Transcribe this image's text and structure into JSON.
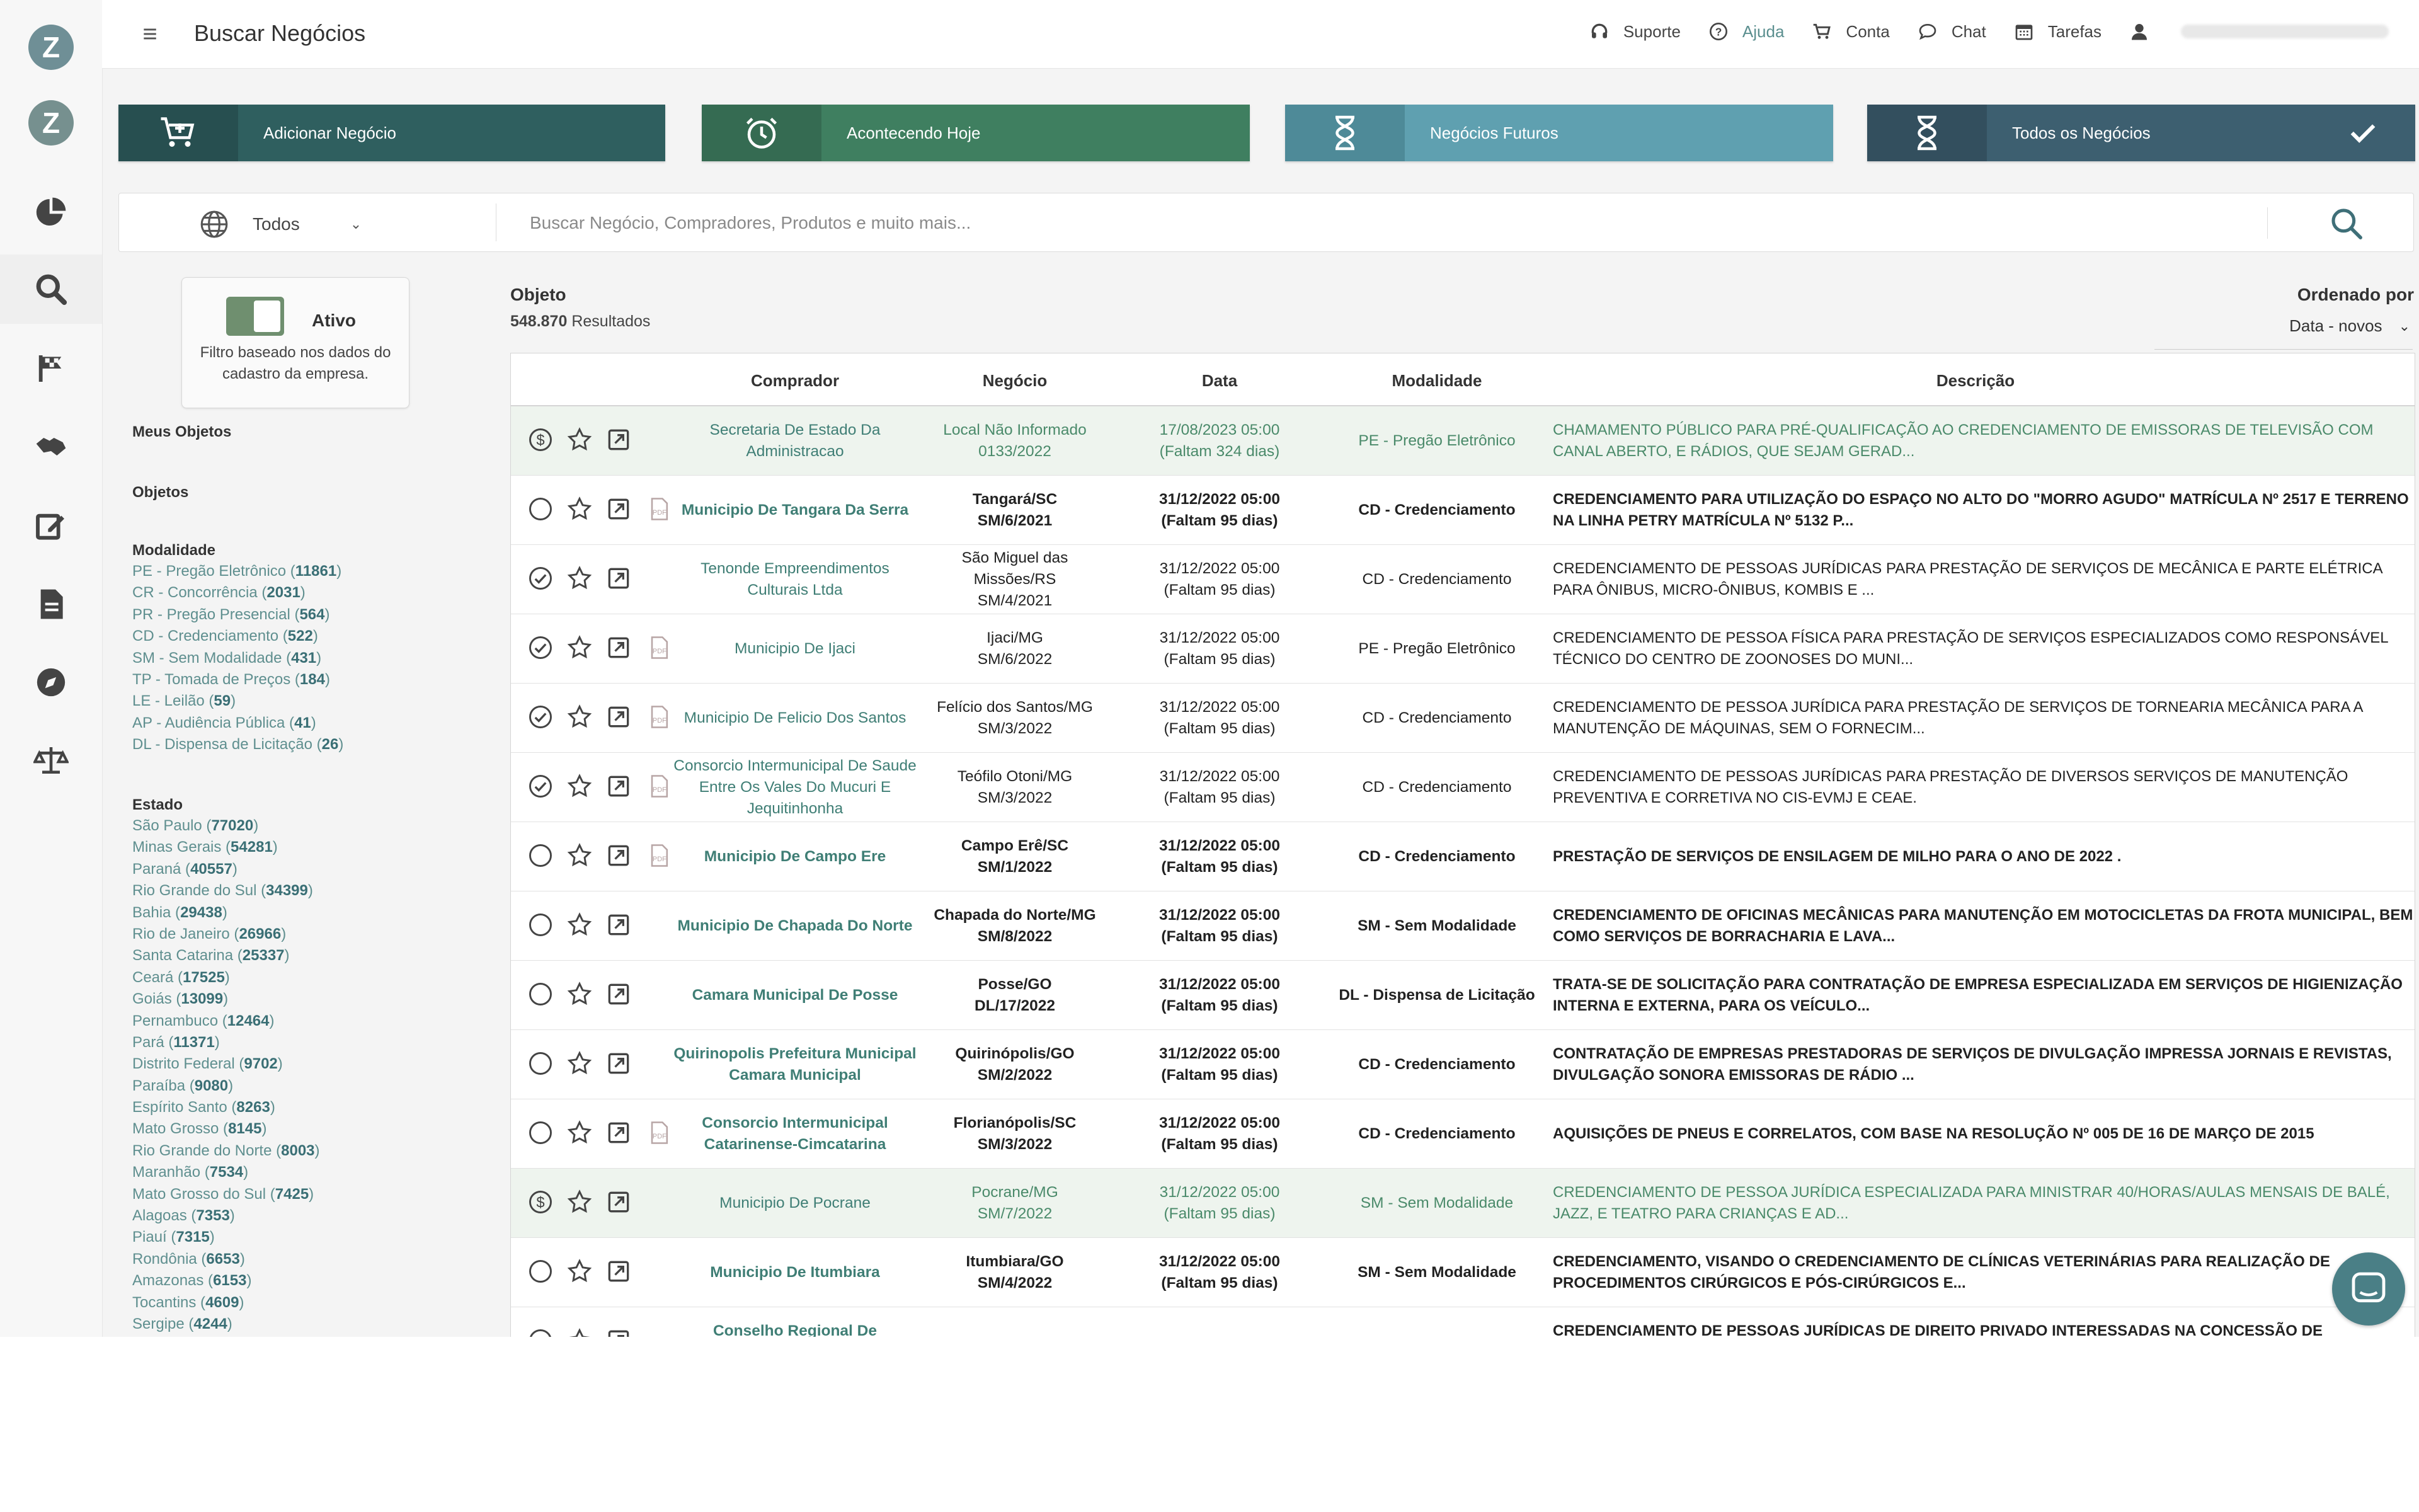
{
  "header": {
    "title": "Buscar Negócios",
    "nav": [
      {
        "label": "Suporte",
        "icon": "headset-icon"
      },
      {
        "label": "Ajuda",
        "icon": "help-circle-icon"
      },
      {
        "label": "Conta",
        "icon": "cart-icon"
      },
      {
        "label": "Chat",
        "icon": "chat-bubble-icon"
      },
      {
        "label": "Tarefas",
        "icon": "calendar-icon"
      }
    ]
  },
  "rail": [
    "logo-icon",
    "logo-icon",
    "pie-chart-icon",
    "search-icon",
    "flag-icon",
    "handshake-icon",
    "edit-icon",
    "document-icon",
    "compass-icon",
    "scales-icon"
  ],
  "tiles": [
    {
      "label": "Adicionar Negócio",
      "color": "#2f5f5f",
      "icon_bg": "#274f50"
    },
    {
      "label": "Acontecendo Hoje",
      "color": "#3f7f60",
      "icon_bg": "#356b52"
    },
    {
      "label": "Negócios Futuros",
      "color": "#5fa0b0",
      "icon_bg": "#4e8a98"
    },
    {
      "label": "Todos os Negócios",
      "color": "#3d5f70",
      "icon_bg": "#334f5e"
    }
  ],
  "search": {
    "scope": "Todos",
    "placeholder": "Buscar Negócio, Compradores, Produtos e muito mais..."
  },
  "filters": {
    "toggle_label": "Ativo",
    "toggle_desc": "Filtro baseado nos dados do cadastro da empresa.",
    "meus_objetos": "Meus Objetos",
    "objetos": "Objetos",
    "modalidade_title": "Modalidade",
    "modalidade": [
      {
        "label": "PE - Pregão Eletrônico",
        "count": "11861"
      },
      {
        "label": "CR - Concorrência",
        "count": "2031"
      },
      {
        "label": "PR - Pregão Presencial",
        "count": "564"
      },
      {
        "label": "CD - Credenciamento",
        "count": "522"
      },
      {
        "label": "SM - Sem Modalidade",
        "count": "431"
      },
      {
        "label": "TP - Tomada de Preços",
        "count": "184"
      },
      {
        "label": "LE - Leilão",
        "count": "59"
      },
      {
        "label": "AP - Audiência Pública",
        "count": "41"
      },
      {
        "label": "DL - Dispensa de Licitação",
        "count": "26"
      }
    ],
    "estado_title": "Estado",
    "estado": [
      {
        "label": "São Paulo",
        "count": "77020"
      },
      {
        "label": "Minas Gerais",
        "count": "54281"
      },
      {
        "label": "Paraná",
        "count": "40557"
      },
      {
        "label": "Rio Grande do Sul",
        "count": "34399"
      },
      {
        "label": "Bahia",
        "count": "29438"
      },
      {
        "label": "Rio de Janeiro",
        "count": "26966"
      },
      {
        "label": "Santa Catarina",
        "count": "25337"
      },
      {
        "label": "Ceará",
        "count": "17525"
      },
      {
        "label": "Goiás",
        "count": "13099"
      },
      {
        "label": "Pernambuco",
        "count": "12464"
      },
      {
        "label": "Pará",
        "count": "11371"
      },
      {
        "label": "Distrito Federal",
        "count": "9702"
      },
      {
        "label": "Paraíba",
        "count": "9080"
      },
      {
        "label": "Espírito Santo",
        "count": "8263"
      },
      {
        "label": "Mato Grosso",
        "count": "8145"
      },
      {
        "label": "Rio Grande do Norte",
        "count": "8003"
      },
      {
        "label": "Maranhão",
        "count": "7534"
      },
      {
        "label": "Mato Grosso do Sul",
        "count": "7425"
      },
      {
        "label": "Alagoas",
        "count": "7353"
      },
      {
        "label": "Piauí",
        "count": "7315"
      },
      {
        "label": "Rondônia",
        "count": "6653"
      },
      {
        "label": "Amazonas",
        "count": "6153"
      },
      {
        "label": "Tocantins",
        "count": "4609"
      },
      {
        "label": "Sergipe",
        "count": "4244"
      }
    ]
  },
  "results": {
    "title": "Objeto",
    "count": "548.870",
    "count_suffix": "Resultados",
    "order_label": "Ordenado por",
    "order_value": "Data - novos",
    "columns": {
      "buyer": "Comprador",
      "deal": "Negócio",
      "date": "Data",
      "mode": "Modalidade",
      "desc": "Descrição"
    },
    "rows": [
      {
        "status": "dollar",
        "doc": false,
        "highlight": true,
        "bold": false,
        "buyer": "Secretaria De Estado Da Administracao",
        "deal": "Local Não Informado\n0133/2022",
        "date": "17/08/2023 05:00\n(Faltam 324 dias)",
        "mode": "PE - Pregão Eletrônico",
        "desc": "CHAMAMENTO PÚBLICO PARA PRÉ-QUALIFICAÇÃO AO CREDENCIAMENTO DE EMISSORAS DE TELEVISÃO COM CANAL ABERTO, E RÁDIOS, QUE SEJAM GERAD..."
      },
      {
        "status": "empty",
        "doc": true,
        "highlight": false,
        "bold": true,
        "buyer": "Municipio De Tangara Da Serra",
        "deal": "Tangará/SC\nSM/6/2021",
        "date": "31/12/2022 05:00\n(Faltam 95 dias)",
        "mode": "CD - Credenciamento",
        "desc": "CREDENCIAMENTO PARA UTILIZAÇÃO DO ESPAÇO NO ALTO DO \"MORRO AGUDO\" MATRÍCULA Nº 2517 E TERRENO NA LINHA PETRY MATRÍCULA Nº 5132 P..."
      },
      {
        "status": "check",
        "doc": false,
        "highlight": false,
        "bold": false,
        "buyer": "Tenonde Empreendimentos Culturais Ltda",
        "deal": "São Miguel das Missões/RS\nSM/4/2021",
        "date": "31/12/2022 05:00\n(Faltam 95 dias)",
        "mode": "CD - Credenciamento",
        "desc": "CREDENCIAMENTO DE PESSOAS JURÍDICAS PARA PRESTAÇÃO DE SERVIÇOS DE MECÂNICA E PARTE ELÉTRICA PARA ÔNIBUS, MICRO-ÔNIBUS, KOMBIS E ..."
      },
      {
        "status": "check",
        "doc": true,
        "highlight": false,
        "bold": false,
        "buyer": "Municipio De Ijaci",
        "deal": "Ijaci/MG\nSM/6/2022",
        "date": "31/12/2022 05:00\n(Faltam 95 dias)",
        "mode": "PE - Pregão Eletrônico",
        "desc": "CREDENCIAMENTO DE PESSOA FÍSICA PARA PRESTAÇÃO DE SERVIÇOS ESPECIALIZADOS COMO RESPONSÁVEL TÉCNICO DO CENTRO DE ZOONOSES DO MUNI..."
      },
      {
        "status": "check",
        "doc": true,
        "highlight": false,
        "bold": false,
        "buyer": "Municipio De Felicio Dos Santos",
        "deal": "Felício dos Santos/MG\nSM/3/2022",
        "date": "31/12/2022 05:00\n(Faltam 95 dias)",
        "mode": "CD - Credenciamento",
        "desc": "CREDENCIAMENTO DE PESSOA JURÍDICA PARA PRESTAÇÃO DE SERVIÇOS DE TORNEARIA MECÂNICA PARA A MANUTENÇÃO DE MÁQUINAS, SEM O FORNECIM..."
      },
      {
        "status": "check",
        "doc": true,
        "highlight": false,
        "bold": false,
        "buyer": "Consorcio Intermunicipal De Saude Entre Os Vales Do Mucuri E Jequitinhonha",
        "deal": "Teófilo Otoni/MG\nSM/3/2022",
        "date": "31/12/2022 05:00\n(Faltam 95 dias)",
        "mode": "CD - Credenciamento",
        "desc": "CREDENCIAMENTO DE PESSOAS JURÍDICAS PARA PRESTAÇÃO DE DIVERSOS SERVIÇOS DE MANUTENÇÃO PREVENTIVA E CORRETIVA NO CIS-EVMJ E CEAE."
      },
      {
        "status": "empty",
        "doc": true,
        "highlight": false,
        "bold": true,
        "buyer": "Municipio De Campo Ere",
        "deal": "Campo Erê/SC\nSM/1/2022",
        "date": "31/12/2022 05:00\n(Faltam 95 dias)",
        "mode": "CD - Credenciamento",
        "desc": "PRESTAÇÃO DE SERVIÇOS DE ENSILAGEM DE MILHO PARA O ANO DE 2022 ."
      },
      {
        "status": "empty",
        "doc": false,
        "highlight": false,
        "bold": true,
        "buyer": "Municipio De Chapada Do Norte",
        "deal": "Chapada do Norte/MG\nSM/8/2022",
        "date": "31/12/2022 05:00\n(Faltam 95 dias)",
        "mode": "SM - Sem Modalidade",
        "desc": "CREDENCIAMENTO DE OFICINAS MECÂNICAS PARA MANUTENÇÃO EM MOTOCICLETAS DA FROTA MUNICIPAL, BEM COMO SERVIÇOS DE BORRACHARIA E LAVA..."
      },
      {
        "status": "empty",
        "doc": false,
        "highlight": false,
        "bold": true,
        "buyer": "Camara Municipal De Posse",
        "deal": "Posse/GO\nDL/17/2022",
        "date": "31/12/2022 05:00\n(Faltam 95 dias)",
        "mode": "DL - Dispensa de Licitação",
        "desc": "TRATA-SE DE SOLICITAÇÃO PARA CONTRATAÇÃO DE EMPRESA ESPECIALIZADA EM SERVIÇOS DE HIGIENIZAÇÃO INTERNA E EXTERNA, PARA OS VEÍCULO..."
      },
      {
        "status": "empty",
        "doc": false,
        "highlight": false,
        "bold": true,
        "buyer": "Quirinopolis Prefeitura Municipal Camara Municipal",
        "deal": "Quirinópolis/GO\nSM/2/2022",
        "date": "31/12/2022 05:00\n(Faltam 95 dias)",
        "mode": "CD - Credenciamento",
        "desc": "CONTRATAÇÃO DE EMPRESAS PRESTADORAS DE SERVIÇOS DE DIVULGAÇÃO IMPRESSA JORNAIS E REVISTAS, DIVULGAÇÃO SONORA EMISSORAS DE RÁDIO ..."
      },
      {
        "status": "empty",
        "doc": true,
        "highlight": false,
        "bold": true,
        "buyer": "Consorcio Intermunicipal Catarinense-Cimcatarina",
        "deal": "Florianópolis/SC\nSM/3/2022",
        "date": "31/12/2022 05:00\n(Faltam 95 dias)",
        "mode": "CD - Credenciamento",
        "desc": "AQUISIÇÕES DE PNEUS E CORRELATOS, COM BASE NA RESOLUÇÃO Nº 005 DE 16 DE MARÇO DE 2015"
      },
      {
        "status": "dollar",
        "doc": false,
        "highlight": true,
        "bold": true,
        "buyer": "Municipio De Pocrane",
        "deal": "Pocrane/MG\nSM/7/2022",
        "date": "31/12/2022 05:00\n(Faltam 95 dias)",
        "mode": "SM - Sem Modalidade",
        "desc": "CREDENCIAMENTO DE PESSOA JURÍDICA ESPECIALIZADA PARA MINISTRAR 40/HORAS/AULAS MENSAIS DE BALÉ, JAZZ, E TEATRO PARA CRIANÇAS E AD..."
      },
      {
        "status": "empty",
        "doc": false,
        "highlight": false,
        "bold": true,
        "buyer": "Municipio De Itumbiara",
        "deal": "Itumbiara/GO\nSM/4/2022",
        "date": "31/12/2022 05:00\n(Faltam 95 dias)",
        "mode": "SM - Sem Modalidade",
        "desc": "CREDENCIAMENTO, VISANDO O CREDENCIAMENTO DE CLÍNICAS VETERINÁRIAS PARA REALIZAÇÃO DE PROCEDIMENTOS CIRÚRGICOS E PÓS-CIRÚRGICOS E..."
      },
      {
        "status": "empty",
        "doc": false,
        "highlight": false,
        "bold": true,
        "buyer": "Conselho Regional De Fisioterapia E Terapia",
        "deal": "",
        "date": "",
        "mode": "",
        "desc": "CREDENCIAMENTO DE PESSOAS JURÍDICAS DE DIREITO PRIVADO INTERESSADAS NA CONCESSÃO DE DESCONTOS"
      }
    ]
  }
}
